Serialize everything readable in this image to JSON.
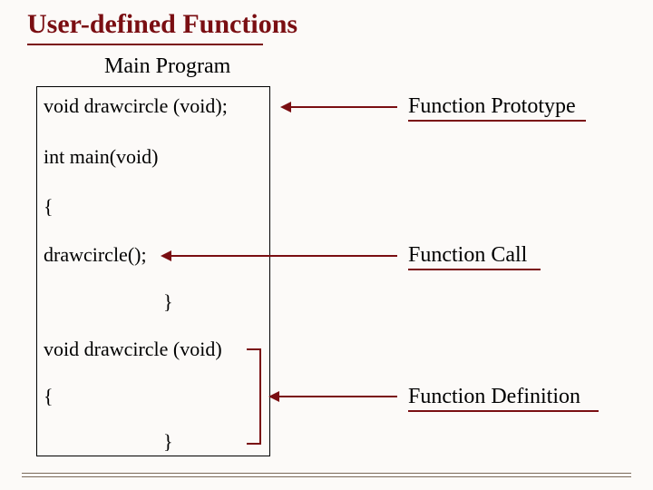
{
  "title": "User-defined Functions",
  "subtitle": "Main Program",
  "code": {
    "prototype": "void drawcircle (void);",
    "main_sig": "int main(void)",
    "open_brace": "{",
    "call": "drawcircle();",
    "close_brace": "}",
    "def_sig": "void drawcircle (void)",
    "def_open": "{",
    "def_close": "}"
  },
  "labels": {
    "prototype": "Function Prototype",
    "call": "Function Call",
    "definition": "Function Definition"
  },
  "colors": {
    "accent": "#7a0e12",
    "bg": "#fcfaf8"
  }
}
